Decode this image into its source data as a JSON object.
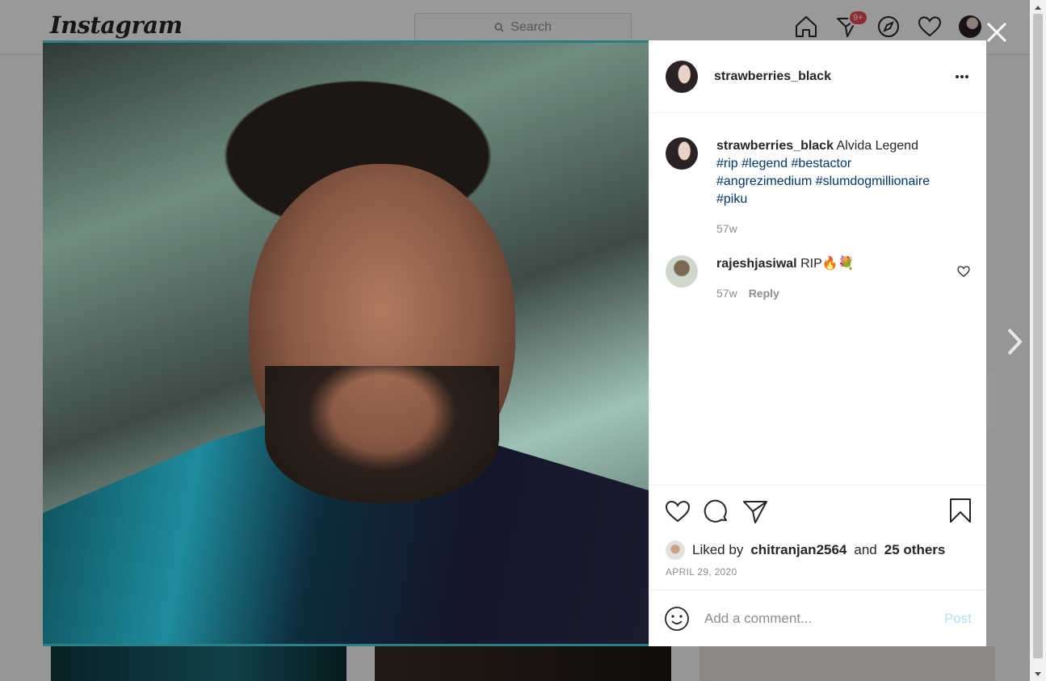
{
  "nav": {
    "logo": "Instagram",
    "search_placeholder": "Search",
    "notifications_badge": "9+"
  },
  "post": {
    "author": "strawberries_black",
    "caption": {
      "username": "strawberries_black",
      "text": "Alvida Legend",
      "hashtags_line1": "#rip #legend #bestactor",
      "hashtags_line2": "#angrezimedium #slumdogmillionaire",
      "hashtags_line3": "#piku",
      "age": "57w"
    },
    "comments": [
      {
        "username": "rajeshjasiwal",
        "text": "RIP🔥💐",
        "age": "57w",
        "reply_label": "Reply"
      }
    ],
    "likes": {
      "prefix": "Liked by",
      "first_liker": "chitranjan2564",
      "joiner": "and",
      "others": "25 others"
    },
    "date": "APRIL 29, 2020",
    "add_comment_placeholder": "Add a comment...",
    "post_label": "Post"
  },
  "colors": {
    "hashtag": "#00376b",
    "badge": "#ed4956",
    "post_button_disabled": "#b2dffc"
  }
}
